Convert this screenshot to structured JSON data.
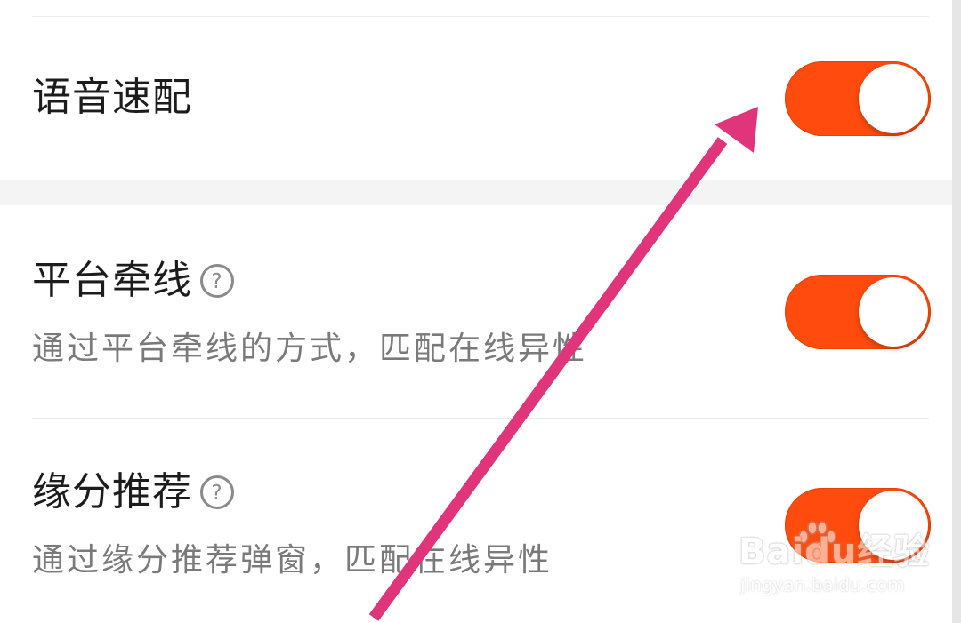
{
  "settings": [
    {
      "title": "语音速配",
      "description": "",
      "has_help": false,
      "toggle_on": true
    },
    {
      "title": "平台牵线",
      "description": "通过平台牵线的方式，匹配在线异性",
      "has_help": true,
      "toggle_on": true
    },
    {
      "title": "缘分推荐",
      "description": "通过缘分推荐弹窗，匹配在线异性",
      "has_help": true,
      "toggle_on": true
    }
  ],
  "colors": {
    "toggle_on": "#ff4b0d",
    "arrow": "#e0357a",
    "title_text": "#1c1c1c",
    "desc_text": "#7a7a7a"
  },
  "watermark": {
    "brand": "Baidu经验",
    "url": "jingyan.baidu.com"
  },
  "icons": [
    "help-icon",
    "annotation-arrow"
  ]
}
